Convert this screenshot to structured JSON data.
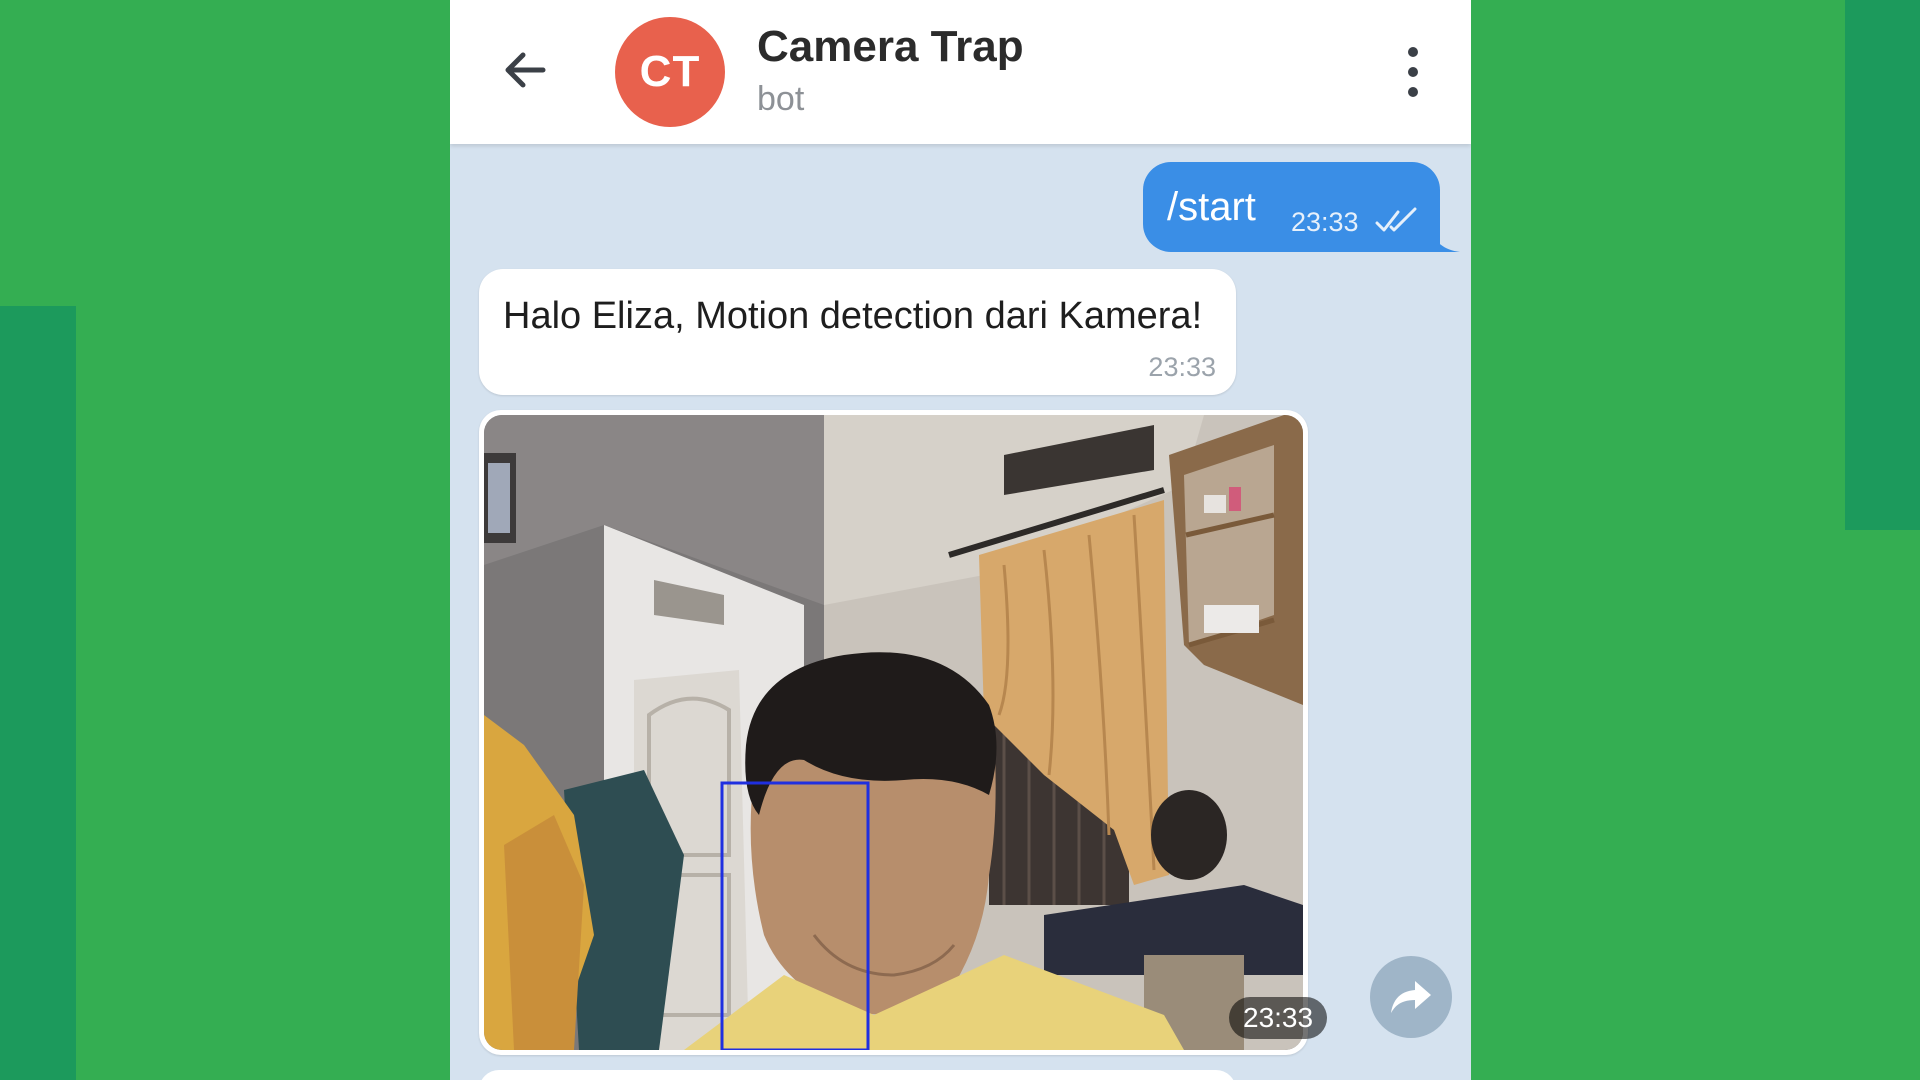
{
  "colors": {
    "background": "#34ae52",
    "accent_panel": "#1c9a5c",
    "chat_background": "#d5e2ef",
    "avatar": "#e8614d",
    "outgoing_bubble": "#3a8ee6",
    "detection_box": "#1f2fe0"
  },
  "header": {
    "back_icon": "arrow-left-icon",
    "avatar_initials": "CT",
    "title": "Camera Trap",
    "subtitle": "bot",
    "menu_icon": "more-vertical-icon"
  },
  "messages": [
    {
      "direction": "outgoing",
      "text": "/start",
      "time": "23:33",
      "status_icon": "double-check-icon"
    },
    {
      "direction": "incoming",
      "text": "Halo Eliza, Motion detection dari Kamera!",
      "time": "23:33"
    },
    {
      "direction": "incoming",
      "type": "photo",
      "time": "23:33",
      "share_icon": "share-icon"
    }
  ]
}
